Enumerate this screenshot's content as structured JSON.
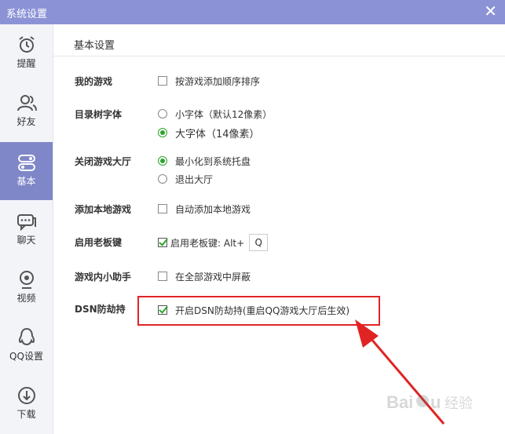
{
  "window": {
    "title": "系统设置",
    "close_label": "✕"
  },
  "sidebar": {
    "items": [
      {
        "label": "提醒",
        "icon": "alarm-clock-icon"
      },
      {
        "label": "好友",
        "icon": "friends-icon"
      },
      {
        "label": "基本",
        "icon": "toggle-settings-icon",
        "active": true
      },
      {
        "label": "聊天",
        "icon": "chat-bubble-icon"
      },
      {
        "label": "视频",
        "icon": "camera-icon"
      },
      {
        "label": "QQ设置",
        "icon": "penguin-icon"
      },
      {
        "label": "下载",
        "icon": "download-icon"
      }
    ]
  },
  "main": {
    "section_title": "基本设置",
    "rows": {
      "my_games": {
        "label": "我的游戏",
        "option": "按游戏添加顺序排序",
        "checked": false
      },
      "font": {
        "label": "目录树字体",
        "options": [
          {
            "label": "小字体（默认12像素）",
            "selected": false
          },
          {
            "label": "大字体（14像素）",
            "selected": true
          }
        ]
      },
      "close_hall": {
        "label": "关闭游戏大厅",
        "options": [
          {
            "label": "最小化到系统托盘",
            "selected": true
          },
          {
            "label": "退出大厅",
            "selected": false
          }
        ]
      },
      "add_local": {
        "label": "添加本地游戏",
        "option": "自动添加本地游戏",
        "checked": false
      },
      "boss_key": {
        "label": "启用老板键",
        "option": "启用老板键: Alt+",
        "key": "Q",
        "checked": true
      },
      "assistant": {
        "label": "游戏内小助手",
        "option": "在全部游戏中屏蔽",
        "checked": false
      },
      "dsn": {
        "label": "DSN防劫持",
        "option": "开启DSN防劫持(重启QQ游戏大厅后生效)",
        "checked": true
      }
    }
  },
  "annotation": {
    "color": "#e02424"
  },
  "watermark": {
    "text": "Baidu 经验"
  }
}
